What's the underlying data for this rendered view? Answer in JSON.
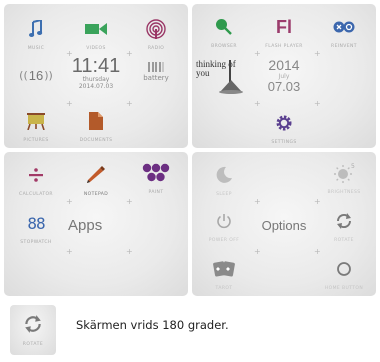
{
  "screen1": {
    "music_label": "MUSIC",
    "videos_label": "VIDEOS",
    "radio_label": "RADIO",
    "volume_value": "16",
    "time": "11:41",
    "day": "thursday",
    "date": "2014.07.03",
    "battery_label": "battery",
    "pictures_label": "PICTURES",
    "documents_label": "DOCUMENTS"
  },
  "screen2": {
    "browser_label": "BROWSER",
    "flash_logo": "Fl",
    "flash_label": "FLASH PLAYER",
    "reinvent_label": "REINVENT",
    "widget_text": "thinking of you",
    "year": "2014",
    "month": "July",
    "day": "07.03",
    "settings_label": "SETTINGS"
  },
  "screen3": {
    "calculator_label": "CALCULATOR",
    "notepad_label": "NOTEPAD",
    "paint_label": "PAINT",
    "stopwatch_value": "88",
    "stopwatch_label": "STOPWATCH",
    "apps_text": "Apps"
  },
  "screen4": {
    "sleep_label": "SLEEP",
    "brightness_label": "BRIGHTNESS",
    "power_label": "POWER OFF",
    "options_text": "Options",
    "rotate_label": "ROTATE",
    "tarot_label": "TAROT",
    "home_label": "HOME BUTTON"
  },
  "caption": {
    "icon_label": "ROTATE",
    "text": "Skärmen vrids 180 grader."
  },
  "colors": {
    "music": "#3d6fb0",
    "videos": "#3aa35b",
    "radio": "#9a3766",
    "browser": "#2f9a4d",
    "flash": "#9b3c6c",
    "calculator": "#a23a67",
    "notepad": "#c25a2a",
    "paint": "#6c2f82",
    "stopwatch": "#3c67ad",
    "settings": "#5a3f8f"
  }
}
